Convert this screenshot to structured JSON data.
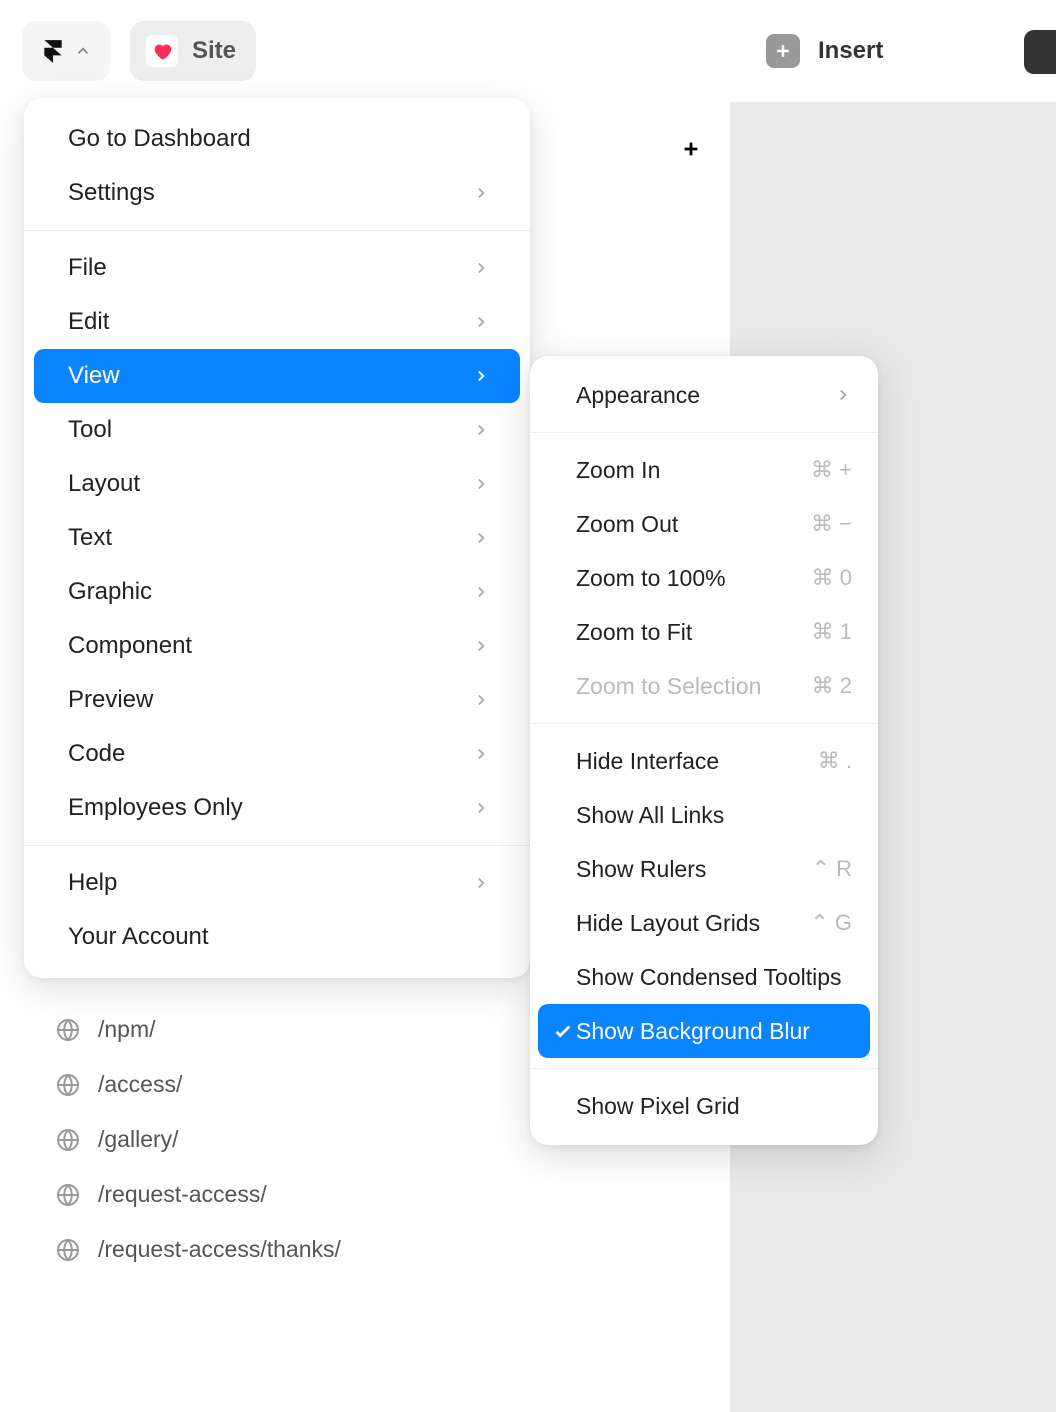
{
  "topbar": {
    "site_label": "Site",
    "insert_label": "Insert"
  },
  "main_menu": {
    "sections": [
      [
        {
          "label": "Go to Dashboard",
          "submenu": false
        },
        {
          "label": "Settings",
          "submenu": true
        }
      ],
      [
        {
          "label": "File",
          "submenu": true
        },
        {
          "label": "Edit",
          "submenu": true
        },
        {
          "label": "View",
          "submenu": true,
          "highlight": true
        },
        {
          "label": "Tool",
          "submenu": true
        },
        {
          "label": "Layout",
          "submenu": true
        },
        {
          "label": "Text",
          "submenu": true
        },
        {
          "label": "Graphic",
          "submenu": true
        },
        {
          "label": "Component",
          "submenu": true
        },
        {
          "label": "Preview",
          "submenu": true
        },
        {
          "label": "Code",
          "submenu": true
        },
        {
          "label": "Employees Only",
          "submenu": true
        }
      ],
      [
        {
          "label": "Help",
          "submenu": true
        },
        {
          "label": "Your Account",
          "submenu": false
        }
      ]
    ]
  },
  "view_submenu": {
    "sections": [
      [
        {
          "label": "Appearance",
          "submenu": true
        }
      ],
      [
        {
          "label": "Zoom In",
          "shortcut": "⌘ +"
        },
        {
          "label": "Zoom Out",
          "shortcut": "⌘ −"
        },
        {
          "label": "Zoom to 100%",
          "shortcut": "⌘ 0"
        },
        {
          "label": "Zoom to Fit",
          "shortcut": "⌘ 1"
        },
        {
          "label": "Zoom to Selection",
          "shortcut": "⌘ 2",
          "disabled": true
        }
      ],
      [
        {
          "label": "Hide Interface",
          "shortcut": "⌘ ."
        },
        {
          "label": "Show All Links"
        },
        {
          "label": "Show Rulers",
          "shortcut": "⌃ R"
        },
        {
          "label": "Hide Layout Grids",
          "shortcut": "⌃ G"
        },
        {
          "label": "Show Condensed Tooltips"
        },
        {
          "label": "Show Background Blur",
          "checked": true
        }
      ],
      [
        {
          "label": "Show Pixel Grid"
        }
      ]
    ]
  },
  "pages": [
    "/npm/",
    "/access/",
    "/gallery/",
    "/request-access/",
    "/request-access/thanks/"
  ]
}
